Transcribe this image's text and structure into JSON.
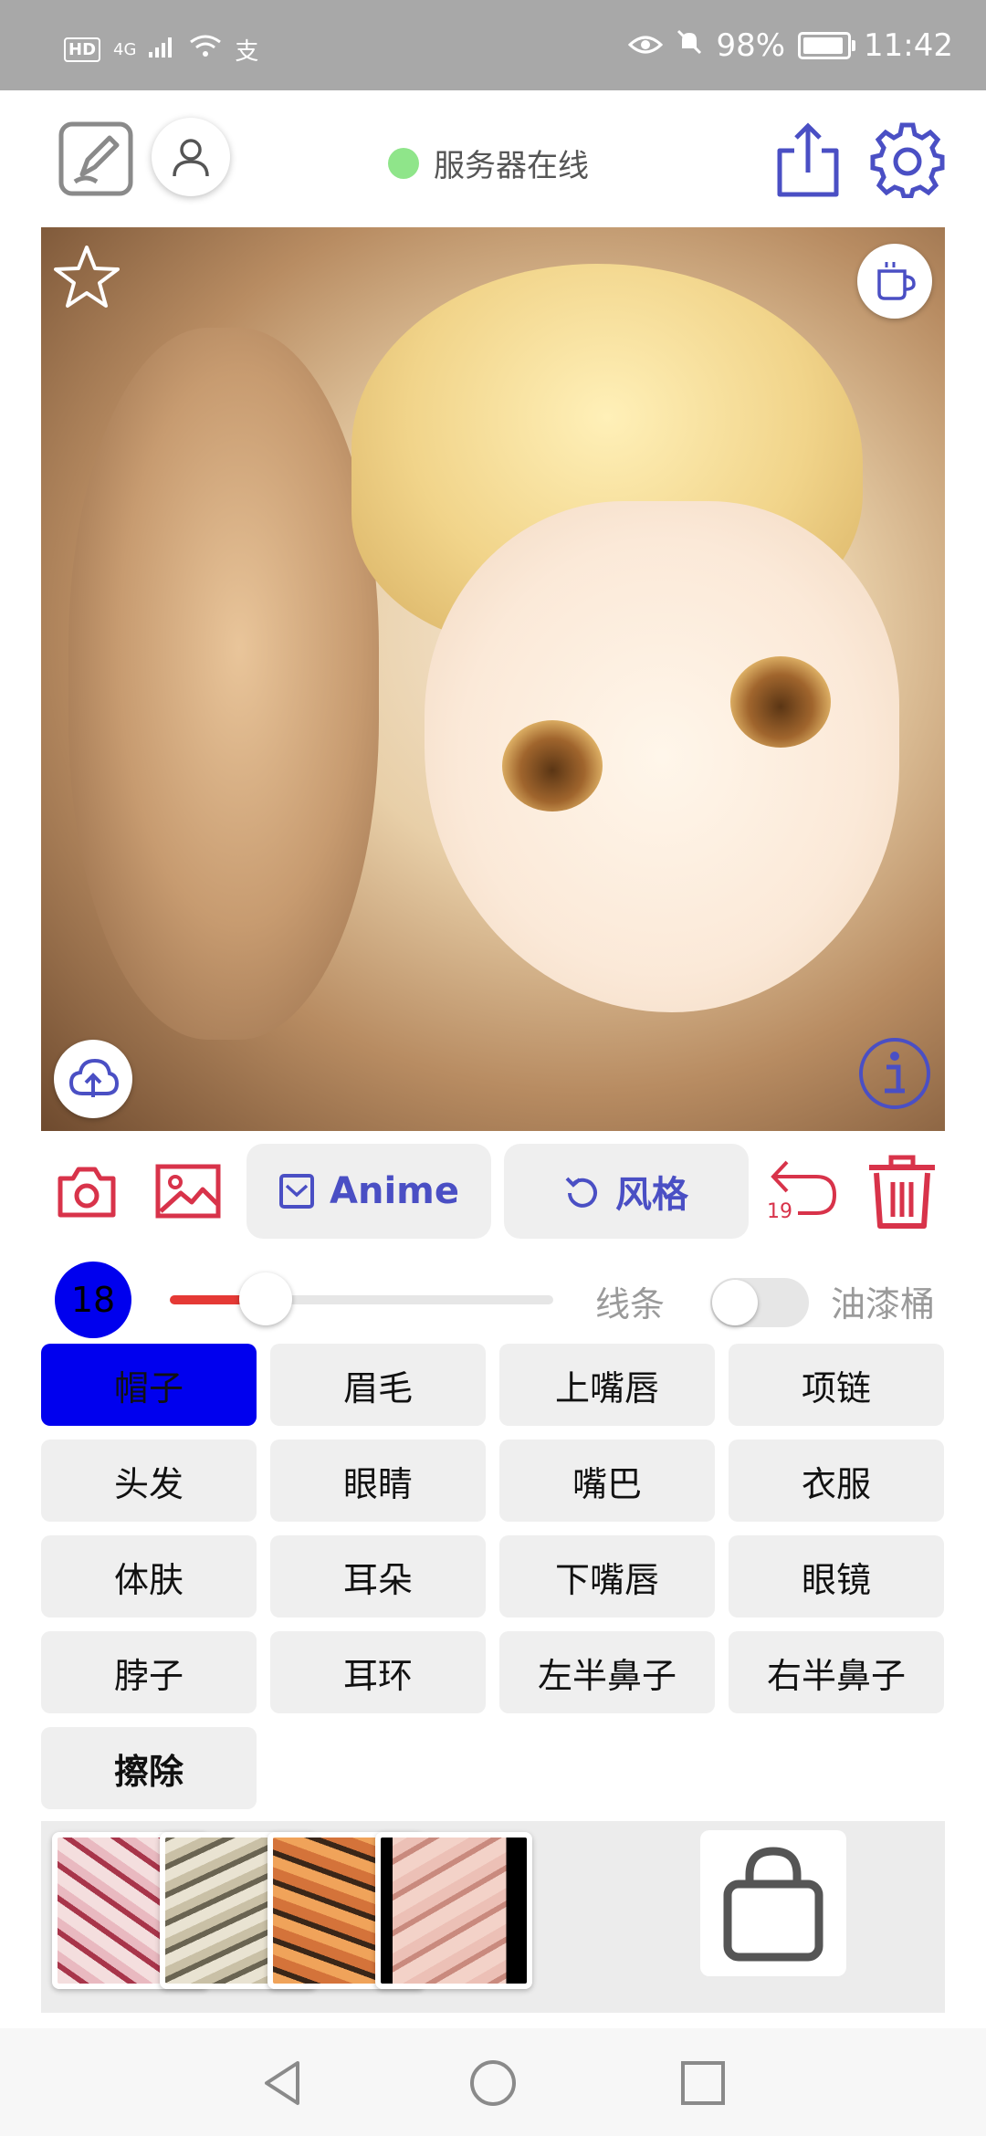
{
  "status_bar": {
    "left_badges": [
      "HD",
      "4G",
      "支"
    ],
    "battery": "98%",
    "time": "11:42"
  },
  "header": {
    "server_status": "服务器在线",
    "server_color": "#8fe58a"
  },
  "toolbar": {
    "anime_label": "Anime",
    "style_label": "风格",
    "undo_count": "19",
    "accent_color": "#4a4fc4",
    "danger_color": "#d8334a"
  },
  "brush": {
    "size": "18",
    "slider_value": 0.25,
    "line_label": "线条",
    "bucket_label": "油漆桶"
  },
  "parts": [
    {
      "label": "帽子",
      "active": true
    },
    {
      "label": "眉毛"
    },
    {
      "label": "上嘴唇"
    },
    {
      "label": "项链"
    },
    {
      "label": "头发"
    },
    {
      "label": "眼睛"
    },
    {
      "label": "嘴巴"
    },
    {
      "label": "衣服"
    },
    {
      "label": "体肤"
    },
    {
      "label": "耳朵"
    },
    {
      "label": "下嘴唇"
    },
    {
      "label": "眼镜"
    },
    {
      "label": "脖子"
    },
    {
      "label": "耳环"
    },
    {
      "label": "左半鼻子"
    },
    {
      "label": "右半鼻子"
    },
    {
      "label": "擦除"
    }
  ],
  "textures": [
    "texture-1",
    "texture-2",
    "texture-3",
    "texture-4"
  ],
  "icons": [
    "edit-icon",
    "user-icon",
    "share-icon",
    "gear-icon",
    "star-icon",
    "cup-icon",
    "upload-cloud-icon",
    "info-icon",
    "camera-icon",
    "image-icon",
    "checkbox-icon",
    "refresh-icon",
    "undo-icon",
    "trash-icon",
    "shopping-bag-icon"
  ]
}
